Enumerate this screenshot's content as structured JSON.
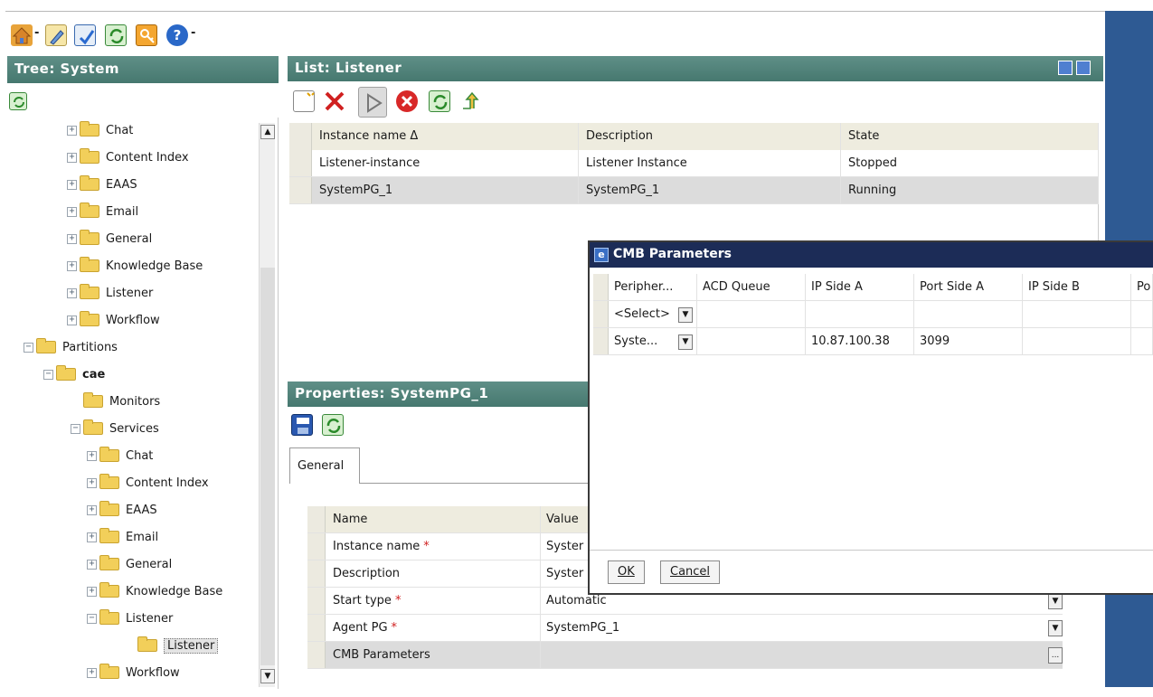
{
  "colors": {
    "panel_header": "#46786f",
    "dialog_title": "#1c2c57",
    "right_strip": "#2e5a93",
    "folder": "#f2cf5a",
    "required_mark": "#d02020"
  },
  "toolbar": {
    "icons": [
      "home-icon",
      "dropdown-arrow-icon",
      "edit-icon",
      "publish-icon",
      "refresh-icon",
      "key-icon",
      "help-icon",
      "dropdown-arrow-icon"
    ],
    "home_arrow": "-",
    "help_arrow": "-"
  },
  "tree": {
    "title": "Tree: System",
    "nodes": [
      {
        "label": "Chat",
        "expander": "+",
        "level": 2
      },
      {
        "label": "Content Index",
        "expander": "+",
        "level": 2
      },
      {
        "label": "EAAS",
        "expander": "+",
        "level": 2
      },
      {
        "label": "Email",
        "expander": "+",
        "level": 2
      },
      {
        "label": "General",
        "expander": "+",
        "level": 2
      },
      {
        "label": "Knowledge Base",
        "expander": "+",
        "level": 2
      },
      {
        "label": "Listener",
        "expander": "+",
        "level": 2
      },
      {
        "label": "Workflow",
        "expander": "+",
        "level": 2
      },
      {
        "label": "Partitions",
        "expander": "−",
        "level": 0
      },
      {
        "label": "cae",
        "expander": "−",
        "level": 1
      },
      {
        "label": "Monitors",
        "expander": "",
        "level": 2
      },
      {
        "label": "Services",
        "expander": "−",
        "level": 2
      },
      {
        "label": "Chat",
        "expander": "+",
        "level": 3
      },
      {
        "label": "Content Index",
        "expander": "+",
        "level": 3
      },
      {
        "label": "EAAS",
        "expander": "+",
        "level": 3
      },
      {
        "label": "Email",
        "expander": "+",
        "level": 3
      },
      {
        "label": "General",
        "expander": "+",
        "level": 3
      },
      {
        "label": "Knowledge Base",
        "expander": "+",
        "level": 3
      },
      {
        "label": "Listener",
        "expander": "−",
        "level": 3
      },
      {
        "label": "Listener",
        "expander": "",
        "level": 4
      },
      {
        "label": "Workflow",
        "expander": "+",
        "level": 3
      }
    ]
  },
  "list": {
    "title": "List: Listener",
    "columns": [
      "Instance name Δ",
      "Description",
      "State"
    ],
    "rows": [
      {
        "name": "Listener-instance",
        "description": "Listener Instance",
        "state": "Stopped"
      },
      {
        "name": "SystemPG_1",
        "description": "SystemPG_1",
        "state": "Running"
      }
    ]
  },
  "properties": {
    "title": "Properties: SystemPG_1",
    "tab": "General",
    "columns": [
      "Name",
      "Value"
    ],
    "rows": [
      {
        "name": "Instance name",
        "required": "*",
        "value": "Syster"
      },
      {
        "name": "Description",
        "required": "",
        "value": "Syster"
      },
      {
        "name": "Start type",
        "required": "*",
        "value": "Automatic"
      },
      {
        "name": "Agent PG",
        "required": "*",
        "value": "SystemPG_1"
      },
      {
        "name": "CMB Parameters",
        "required": "",
        "value": ""
      }
    ],
    "ellipsis": "..."
  },
  "dialog": {
    "title": "CMB Parameters",
    "columns": [
      "Peripher...",
      "ACD Queue",
      "IP Side A",
      "Port Side A",
      "IP Side B",
      "Po"
    ],
    "rows": [
      [
        "<Select>",
        "",
        "",
        "",
        "",
        ""
      ],
      [
        "Syste...",
        "",
        "10.87.100.38",
        "3099",
        "",
        ""
      ]
    ],
    "ok": "OK",
    "cancel": "Cancel"
  }
}
